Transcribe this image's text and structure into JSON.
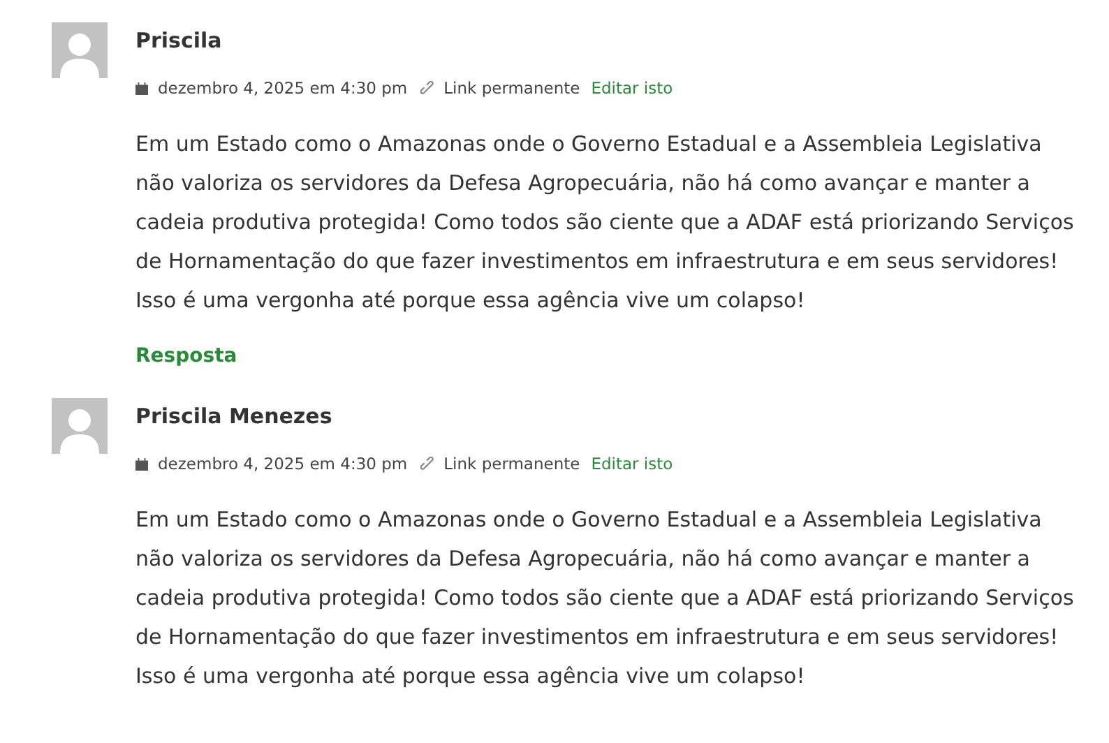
{
  "comments": [
    {
      "author": "Priscila",
      "date": "dezembro 4, 2025 em 4:30 pm",
      "permalink": "Link permanente",
      "edit": "Editar isto",
      "text": "Em um Estado como o Amazonas onde o Governo Estadual e a Assembleia Legislativa não valoriza os servidores da Defesa Agropecuária, não há como avançar e manter a cadeia produtiva protegida! Como todos são ciente que a ADAF está priorizando Serviços de Hornamentação do que fazer investimentos em infraestrutura e em seus servidores! Isso é uma vergonha até porque essa agência vive um colapso!",
      "reply": "Resposta"
    },
    {
      "author": "Priscila Menezes",
      "date": "dezembro 4, 2025 em 4:30 pm",
      "permalink": "Link permanente",
      "edit": "Editar isto",
      "text": "Em um Estado como o Amazonas onde o Governo Estadual e a Assembleia Legislativa não valoriza os servidores da Defesa Agropecuária, não há como avançar e manter a cadeia produtiva protegida! Como todos são ciente que a ADAF está priorizando Serviços de Hornamentação do que fazer investimentos em infraestrutura e em seus servidores! Isso é uma vergonha até porque essa agência vive um colapso!"
    }
  ]
}
